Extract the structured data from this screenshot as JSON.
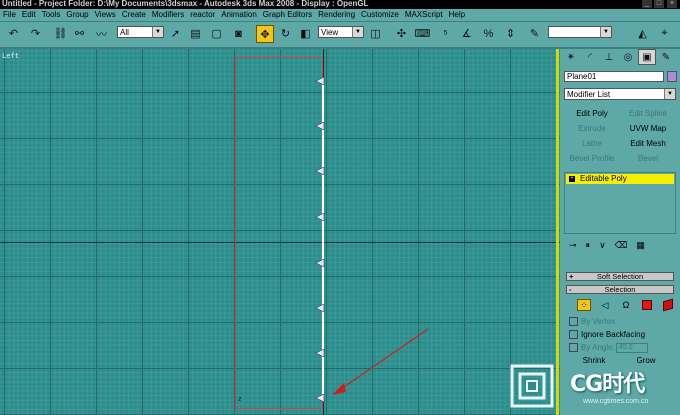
{
  "titlebar": {
    "title": "Untitled    - Project Folder: D:\\My Documents\\3dsmax    - Autodesk 3ds Max 2008    - Display : OpenGL",
    "buttons": [
      "_",
      "□",
      "×"
    ]
  },
  "menubar": {
    "items": [
      "File",
      "Edit",
      "Tools",
      "Group",
      "Views",
      "Create",
      "Modifiers",
      "reactor",
      "Animation",
      "Graph Editors",
      "Rendering",
      "Customize",
      "MAXScript",
      "Help"
    ]
  },
  "toolbar": {
    "selection_filter": "All",
    "reference_coord": "View",
    "named_selection": ""
  },
  "viewport": {
    "label": "Left",
    "bottom_marker": "z"
  },
  "command_panel": {
    "object_name": "Plane01",
    "object_color": "#a98bd8",
    "modifier_list": "Modifier List",
    "modifier_buttons": [
      {
        "label": "Edit Poly",
        "enabled": true
      },
      {
        "label": "Edit Spline",
        "enabled": false
      },
      {
        "label": "Extrude",
        "enabled": false
      },
      {
        "label": "UVW Map",
        "enabled": true
      },
      {
        "label": "Lathe",
        "enabled": false
      },
      {
        "label": "Edit Mesh",
        "enabled": true
      },
      {
        "label": "Bevel Profile",
        "enabled": false
      },
      {
        "label": "Bevel",
        "enabled": false
      }
    ],
    "stack": {
      "selected_item": "Editable Poly",
      "expand_sign": "+"
    },
    "rollouts": {
      "soft_selection": {
        "label": "Soft Selection",
        "sign": "+"
      },
      "selection": {
        "label": "Selection",
        "sign": "-"
      }
    },
    "selection": {
      "by_vertex": "By Vertex",
      "ignore_backfacing": "Ignore Backfacing",
      "by_angle": "By Angle:",
      "angle_value": "45.0",
      "shrink": "Shrink",
      "grow": "Grow"
    }
  },
  "watermark": {
    "text": "CG时代",
    "url": "www.cgtimes.com.cn"
  },
  "colors": {
    "ui_background": "#5fa8a8",
    "viewport_background": "#2e8c8c",
    "active_tool": "#f4c417",
    "selection_highlight": "#f0f000",
    "plane_outline": "#d04040",
    "arrow": "#cc2020"
  },
  "icons": {
    "toolbar": [
      "undo-icon",
      "redo-icon",
      "select-and-link-icon",
      "unlink-icon",
      "bind-space-warp-icon",
      "select-object-icon",
      "select-by-name-icon",
      "rectangle-selection-icon",
      "window-crossing-icon",
      "select-and-move-icon",
      "select-and-rotate-icon",
      "select-and-scale-icon",
      "pivot-center-icon",
      "select-and-manipulate-icon",
      "snaps-toggle-icon",
      "angle-snap-icon",
      "percent-snap-icon",
      "spinner-snap-icon",
      "edit-named-selection-icon",
      "mirror-icon"
    ],
    "command_tabs": [
      "create-tab-icon",
      "modify-tab-icon",
      "hierarchy-tab-icon",
      "motion-tab-icon",
      "display-tab-icon",
      "utilities-tab-icon"
    ],
    "stack_tools": [
      "pin-stack-icon",
      "show-end-result-icon",
      "make-unique-icon",
      "remove-modifier-icon",
      "configure-modifier-sets-icon"
    ],
    "subobject": [
      "vertex-icon",
      "edge-icon",
      "border-icon",
      "polygon-icon",
      "element-icon"
    ]
  }
}
